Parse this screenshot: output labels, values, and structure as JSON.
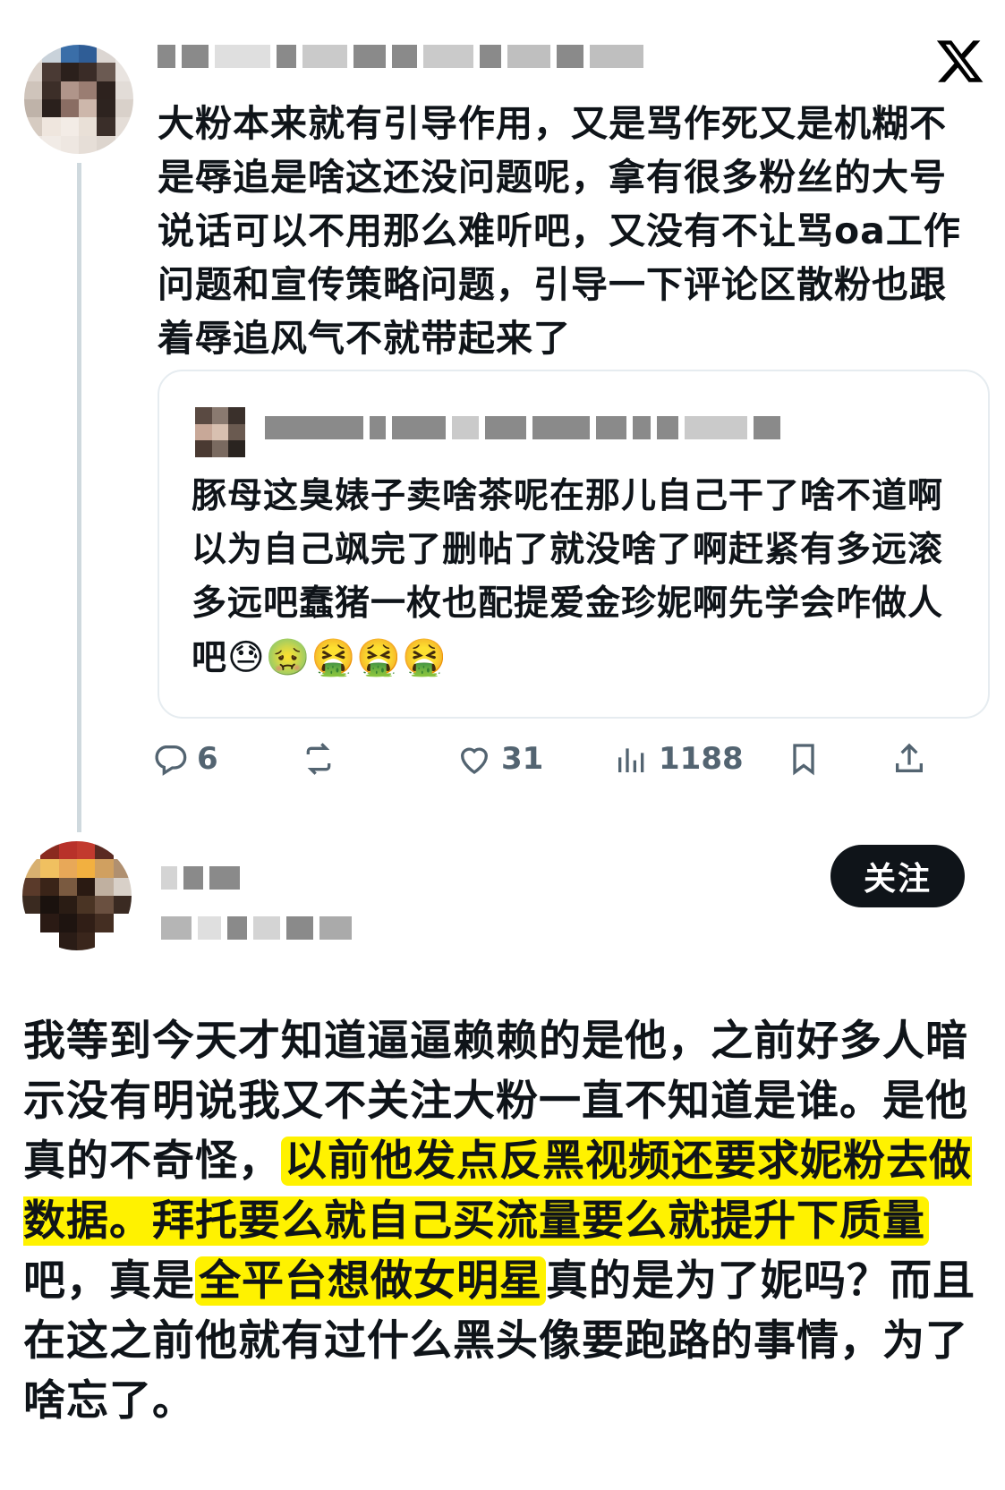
{
  "first_tweet": {
    "text": "大粉本来就有引导作用，又是骂作死又是机糊不是辱追是啥这还没问题呢，拿有很多粉丝的大号说话可以不用那么难听吧，又没有不让骂oa工作问题和宣传策略问题，引导一下评论区散粉也跟着辱追风气不就带起来了",
    "quoted": {
      "text": "豚母这臭婊子卖啥茶呢在那儿自己干了啥不道啊以为自己飒完了删帖了就没啥了啊赶紧有多远滚多远吧蠢猪一枚也配提爱金珍妮啊先学会咋做人吧",
      "emojis": "😓🤢🤮🤮🤮"
    },
    "actions": {
      "reply_icon": "reply-icon",
      "reply_count": "6",
      "retweet_icon": "retweet-icon",
      "like_icon": "heart-icon",
      "like_count": "31",
      "views_icon": "views-icon",
      "view_count": "1188",
      "bookmark_icon": "bookmark-icon",
      "share_icon": "share-icon"
    }
  },
  "second_user": {
    "follow_label": "关注"
  },
  "second_post": {
    "text_before": "我等到今天才知道逼逼赖赖的是他，之前好多人暗示没有明说我又不关注大粉一直不知道是谁。是他真的不奇怪，",
    "highlight_1": "以前他发点反黑视频还要求妮粉去做数据。拜托要么就自己买流量要么就提升下质量",
    "text_middle": "吧，真是",
    "highlight_2": "全平台想做女明星",
    "text_after": "真的是为了妮吗？而且在这之前他就有过什么黑头像要跑路的事情，为了啥忘了。"
  },
  "colors": {
    "highlight": "#fff200",
    "text": "#0f1419",
    "muted": "#536471",
    "thread_line": "#cfd9de",
    "button_bg": "#0f1419"
  }
}
